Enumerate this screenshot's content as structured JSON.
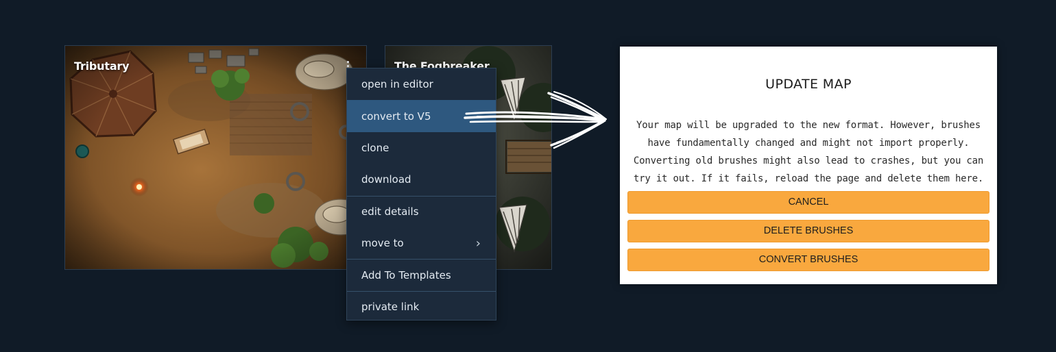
{
  "maps": [
    {
      "title": "Tributary"
    },
    {
      "title": "The Fogbreaker"
    }
  ],
  "kebab_icon": "more-vertical-icon",
  "context_menu": {
    "items": [
      {
        "label": "open in editor"
      },
      {
        "label": "convert to V5",
        "active": true
      },
      {
        "label": "clone"
      },
      {
        "label": "download"
      },
      {
        "label": "edit details"
      },
      {
        "label": "move to",
        "icon": "chevron-right-icon"
      },
      {
        "label": "Add To Templates"
      },
      {
        "label": "private link"
      }
    ]
  },
  "arrow_icon": "hand-drawn-arrow-icon",
  "dialog": {
    "title": "UPDATE MAP",
    "body": "Your map will be upgraded to the new format. However, brushes have fundamentally changed and might not import properly. Converting old brushes might also lead to crashes, but you can try it out. If it fails, reload the page and delete them here.",
    "buttons": {
      "cancel": "CANCEL",
      "delete": "DELETE BRUSHES",
      "convert": "CONVERT BRUSHES"
    }
  },
  "colors": {
    "page_background": "#101b27",
    "menu_background": "#1c2a3b",
    "menu_active": "#2e587f",
    "button_accent": "#f9a83e",
    "dialog_background": "#ffffff"
  }
}
